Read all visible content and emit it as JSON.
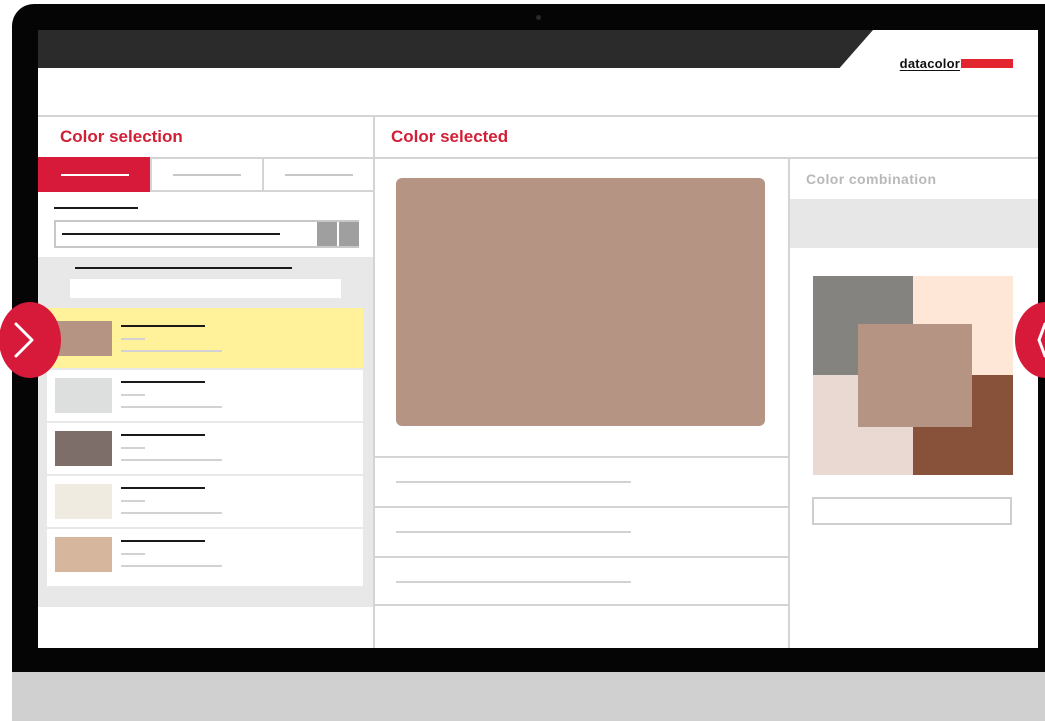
{
  "brand": {
    "name": "datacolor",
    "accent": "#e32530"
  },
  "panels": {
    "left_title": "Color selection",
    "center_title": "Color selected",
    "right_title": "Color combination"
  },
  "tabs": [
    {
      "active": true
    },
    {
      "active": false
    },
    {
      "active": false
    }
  ],
  "color_list": [
    {
      "swatch": "#b59484",
      "selected": true
    },
    {
      "swatch": "#dcdfde",
      "selected": false
    },
    {
      "swatch": "#7e6e69",
      "selected": false
    },
    {
      "swatch": "#efebe1",
      "selected": false
    },
    {
      "swatch": "#d6b69d",
      "selected": false
    }
  ],
  "selected_color": "#b59484",
  "combination": {
    "gray": "#858380",
    "peach": "#fee7d7",
    "blush": "#ead9d2",
    "brown": "#87513a",
    "center": "#b59484"
  },
  "colors": {
    "accent_red": "#d7193a",
    "highlight_yellow": "#fff29a",
    "divider": "#d4d4d4"
  },
  "icons": {
    "prev_arrow": "chevron-right-icon",
    "next_arrow": "chevron-left-icon"
  }
}
